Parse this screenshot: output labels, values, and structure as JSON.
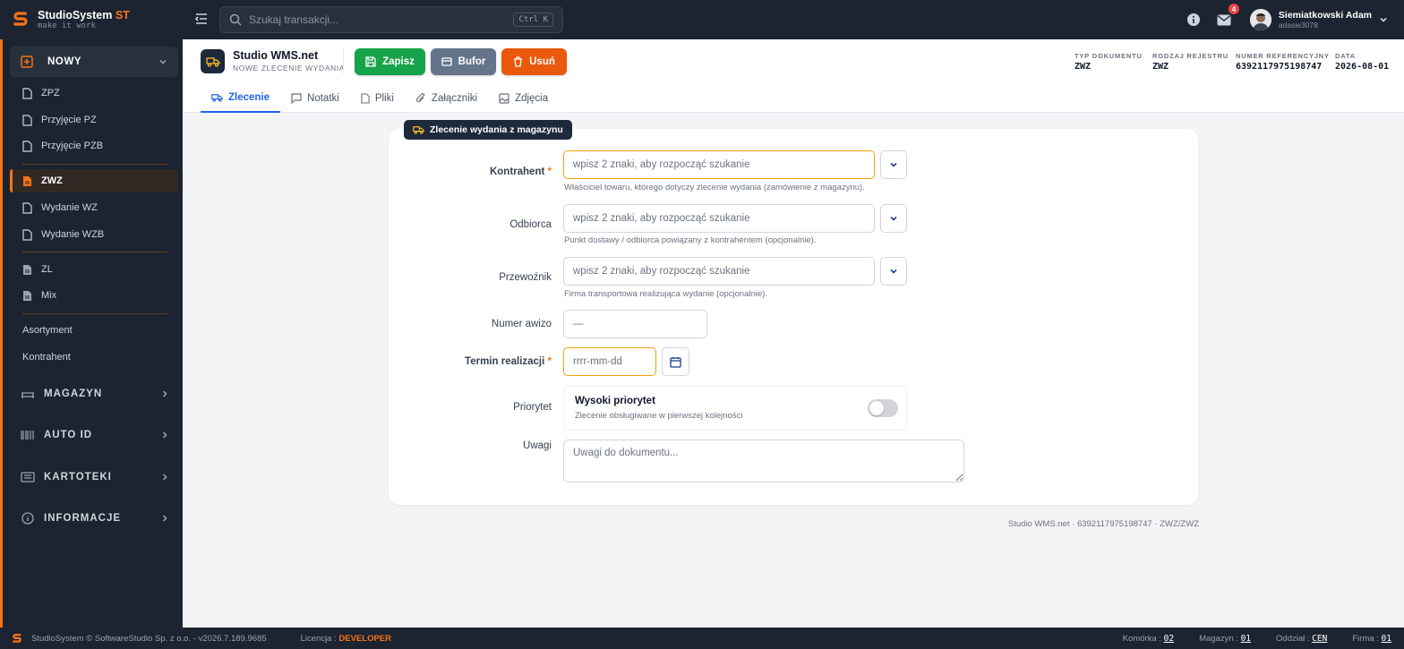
{
  "app": {
    "name": "StudioSystem",
    "name_suffix": "ST",
    "tagline": "make it work",
    "accent": "#f97316"
  },
  "search": {
    "placeholder": "Szukaj transakcji...",
    "shortcut": "Ctrl K"
  },
  "header": {
    "messages_count": "4",
    "user_name": "Siemiatkowski Adam",
    "user_login": "adasie3078"
  },
  "sidebar": {
    "group_label": "NOWY",
    "items": [
      {
        "label": "ZPZ"
      },
      {
        "label": "Przyjęcie PZ"
      },
      {
        "label": "Przyjęcie PZB"
      },
      {
        "label": "ZWZ"
      },
      {
        "label": "Wydanie WZ"
      },
      {
        "label": "Wydanie WZB"
      },
      {
        "label": "ZL"
      },
      {
        "label": "Mix"
      }
    ],
    "plain": [
      "Asortyment",
      "Kontrahent"
    ],
    "sections": [
      "MAGAZYN",
      "AUTO ID",
      "KARTOTEKI",
      "INFORMACJE"
    ]
  },
  "document": {
    "title": "Studio WMS.net",
    "subtitle": "NOWE ZLECENIE WYDANIA",
    "save_label": "Zapisz",
    "buffer_label": "Bufor",
    "delete_label": "Usuń",
    "meta": [
      {
        "key": "TYP DOKUMENTU",
        "value": "ZWZ"
      },
      {
        "key": "RODZAJ REJESTRU",
        "value": "ZWZ"
      },
      {
        "key": "NUMER REFERENCYJNY",
        "value": "6392117975198747"
      },
      {
        "key": "DATA",
        "value": "2026-08-01"
      }
    ],
    "tabs": [
      "Zlecenie",
      "Notatki",
      "Pliki",
      "Załączniki",
      "Zdjęcia"
    ]
  },
  "form": {
    "card_tag": "Zlecenie wydania z magazynu",
    "contractor_label": "Kontrahent",
    "contractor_placeholder": "wpisz 2 znaki, aby rozpocząć szukanie",
    "contractor_hint": "Właściciel towaru, którego dotyczy zlecenie wydania (zamówienie z magazynu).",
    "recipient_label": "Odbiorca",
    "recipient_placeholder": "wpisz 2 znaki, aby rozpocząć szukanie",
    "recipient_hint": "Punkt dostawy / odbiorca powiązany z kontrahentem (opcjonalnie).",
    "carrier_label": "Przewoźnik",
    "carrier_placeholder": "wpisz 2 znaki, aby rozpocząć szukanie",
    "carrier_hint": "Firma transportowa realizująca wydanie (opcjonalnie).",
    "advice_label": "Numer awizo",
    "advice_placeholder": "—",
    "date_label": "Termin realizacji",
    "date_placeholder": "rrrr-mm-dd",
    "priority_label": "Priorytet",
    "priority_title": "Wysoki priorytet",
    "priority_desc": "Zlecenie obsługiwane w pierwszej kolejności",
    "priority_on": false,
    "notes_label": "Uwagi",
    "notes_placeholder": "Uwagi do dokumentu...",
    "required_mark": "*"
  },
  "footnote": "Studio WMS.net · 6392117975198747 · ZWZ/ZWZ",
  "statusbar": {
    "copyright": "StudioSystem © SoftwareStudio Sp. z o.o. - v2026.7.189.9685",
    "license_label": "Licencja :",
    "license_value": "DEVELOPER",
    "cell_label": "Komórka :",
    "cell_value": "02",
    "warehouse_label": "Magazyn :",
    "warehouse_value": "01",
    "branch_label": "Oddział :",
    "branch_value": "CEN",
    "company_label": "Firma :",
    "company_value": "01"
  }
}
